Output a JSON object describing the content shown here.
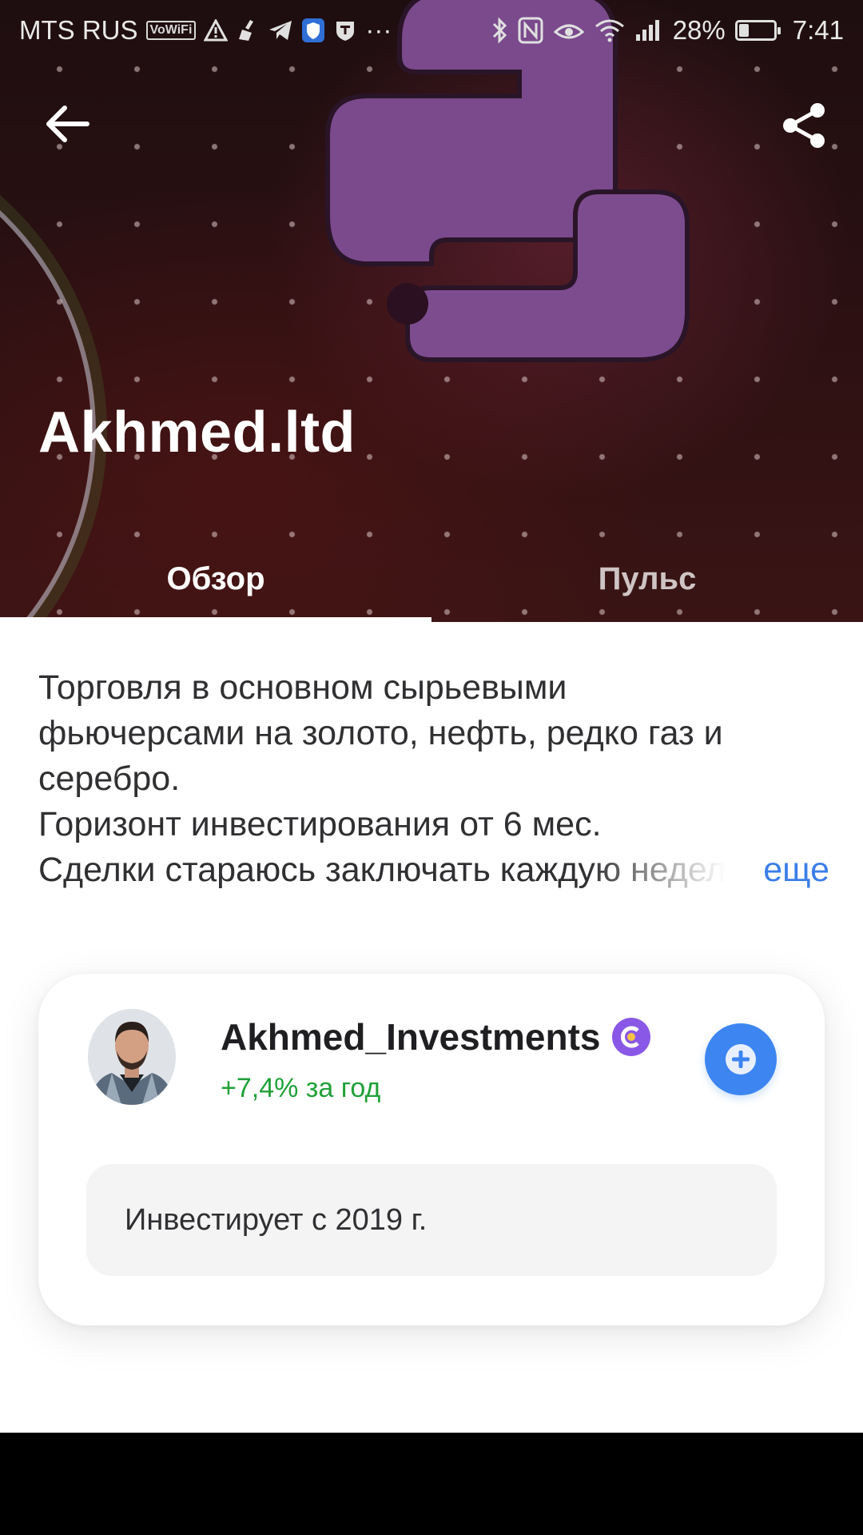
{
  "status_bar": {
    "carrier": "MTS RUS",
    "vowifi_label": "VoWiFi",
    "battery_percent": "28%",
    "battery_level": 0.28,
    "time": "7:41",
    "more_label": "···",
    "icons_left": [
      "warning-icon",
      "cleaner-icon",
      "telegram-icon",
      "shield-icon",
      "tinkoff-icon"
    ],
    "icons_right": [
      "bluetooth-icon",
      "nfc-icon",
      "eye-comfort-icon",
      "wifi-icon",
      "signal-icon",
      "battery-icon"
    ]
  },
  "header": {
    "title": "Akhmed.ltd",
    "back_icon": "arrow-left-icon",
    "share_icon": "share-icon",
    "background_logo": "python-logo"
  },
  "tabs": [
    {
      "label": "Обзор",
      "active": true
    },
    {
      "label": "Пульс",
      "active": false
    }
  ],
  "description": {
    "lines": [
      "Торговля в основном сырьевыми",
      "фьючерсами на золото, нефть, редко газ и",
      "серебро.",
      "Горизонт инвестирования от 6 мес."
    ],
    "last_line": "Сделки стараюсь заключать каждую неделю",
    "more_label": "еще"
  },
  "author_card": {
    "name": "Akhmed_Investments",
    "badge_icon": "verified-badge-icon",
    "yearly_return": "+7,4% за год",
    "subscribe_icon": "plus-icon",
    "investing_since": "Инвестирует с 2019 г."
  },
  "colors": {
    "accent_blue": "#3d86f1",
    "link_blue": "#3b7ee9",
    "positive_green": "#21a038",
    "badge_purple": "#8a58e6",
    "python_purple": "#7a4a8c"
  }
}
